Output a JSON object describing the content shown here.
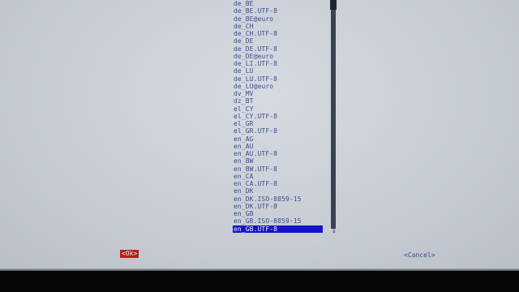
{
  "locale_list": {
    "items": [
      {
        "label": "de_BE"
      },
      {
        "label": "de_BE.UTF-8"
      },
      {
        "label": "de_BE@euro"
      },
      {
        "label": "de_CH"
      },
      {
        "label": "de_CH.UTF-8"
      },
      {
        "label": "de_DE"
      },
      {
        "label": "de_DE.UTF-8"
      },
      {
        "label": "de_DE@euro"
      },
      {
        "label": "de_LI.UTF-8"
      },
      {
        "label": "de_LU"
      },
      {
        "label": "de_LU.UTF-8"
      },
      {
        "label": "de_LU@euro"
      },
      {
        "label": "dv_MV"
      },
      {
        "label": "dz_BT"
      },
      {
        "label": "el_CY"
      },
      {
        "label": "el_CY.UTF-8"
      },
      {
        "label": "el_GR"
      },
      {
        "label": "el_GR.UTF-8"
      },
      {
        "label": "en_AG"
      },
      {
        "label": "en_AU"
      },
      {
        "label": "en_AU.UTF-8"
      },
      {
        "label": "en_BW"
      },
      {
        "label": "en_BW.UTF-8"
      },
      {
        "label": "en_CA"
      },
      {
        "label": "en_CA.UTF-8"
      },
      {
        "label": "en_DK"
      },
      {
        "label": "en_DK.ISO-8859-15"
      },
      {
        "label": "en_DK.UTF-8"
      },
      {
        "label": "en_GB"
      },
      {
        "label": "en_GB.ISO-8859-15"
      },
      {
        "label": "en_GB.UTF-8",
        "selected": true
      }
    ]
  },
  "scrollbar": {
    "down_arrow": "↓"
  },
  "buttons": {
    "ok_label": "<Ok>",
    "cancel_label": "<Cancel>"
  },
  "colors": {
    "screen_background": "#c7ccd4",
    "list_text": "#3f4d86",
    "selection_background": "#1414c8",
    "ok_button_background": "#b32020"
  }
}
